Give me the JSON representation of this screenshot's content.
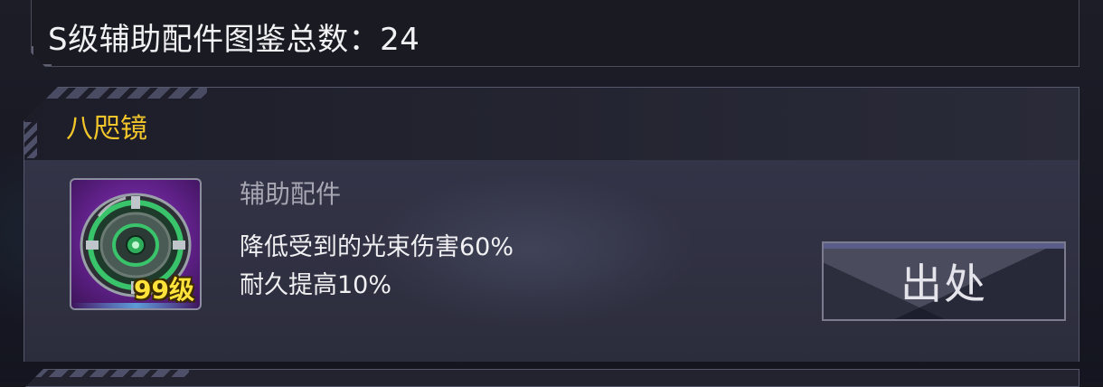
{
  "header": {
    "title": "S级辅助配件图鉴总数：24"
  },
  "item": {
    "name": "八咫镜",
    "level_badge": "99级",
    "category": "辅助配件",
    "effects": [
      "降低受到的光束伤害60%",
      "耐久提高10%"
    ],
    "icon": "shield-mirror-icon",
    "source_button_label": "出处"
  },
  "colors": {
    "item_name": "#f2c52a",
    "level_badge": "#ffe23a",
    "icon_background": "#6a2596",
    "icon_accent": "#39c36a"
  }
}
